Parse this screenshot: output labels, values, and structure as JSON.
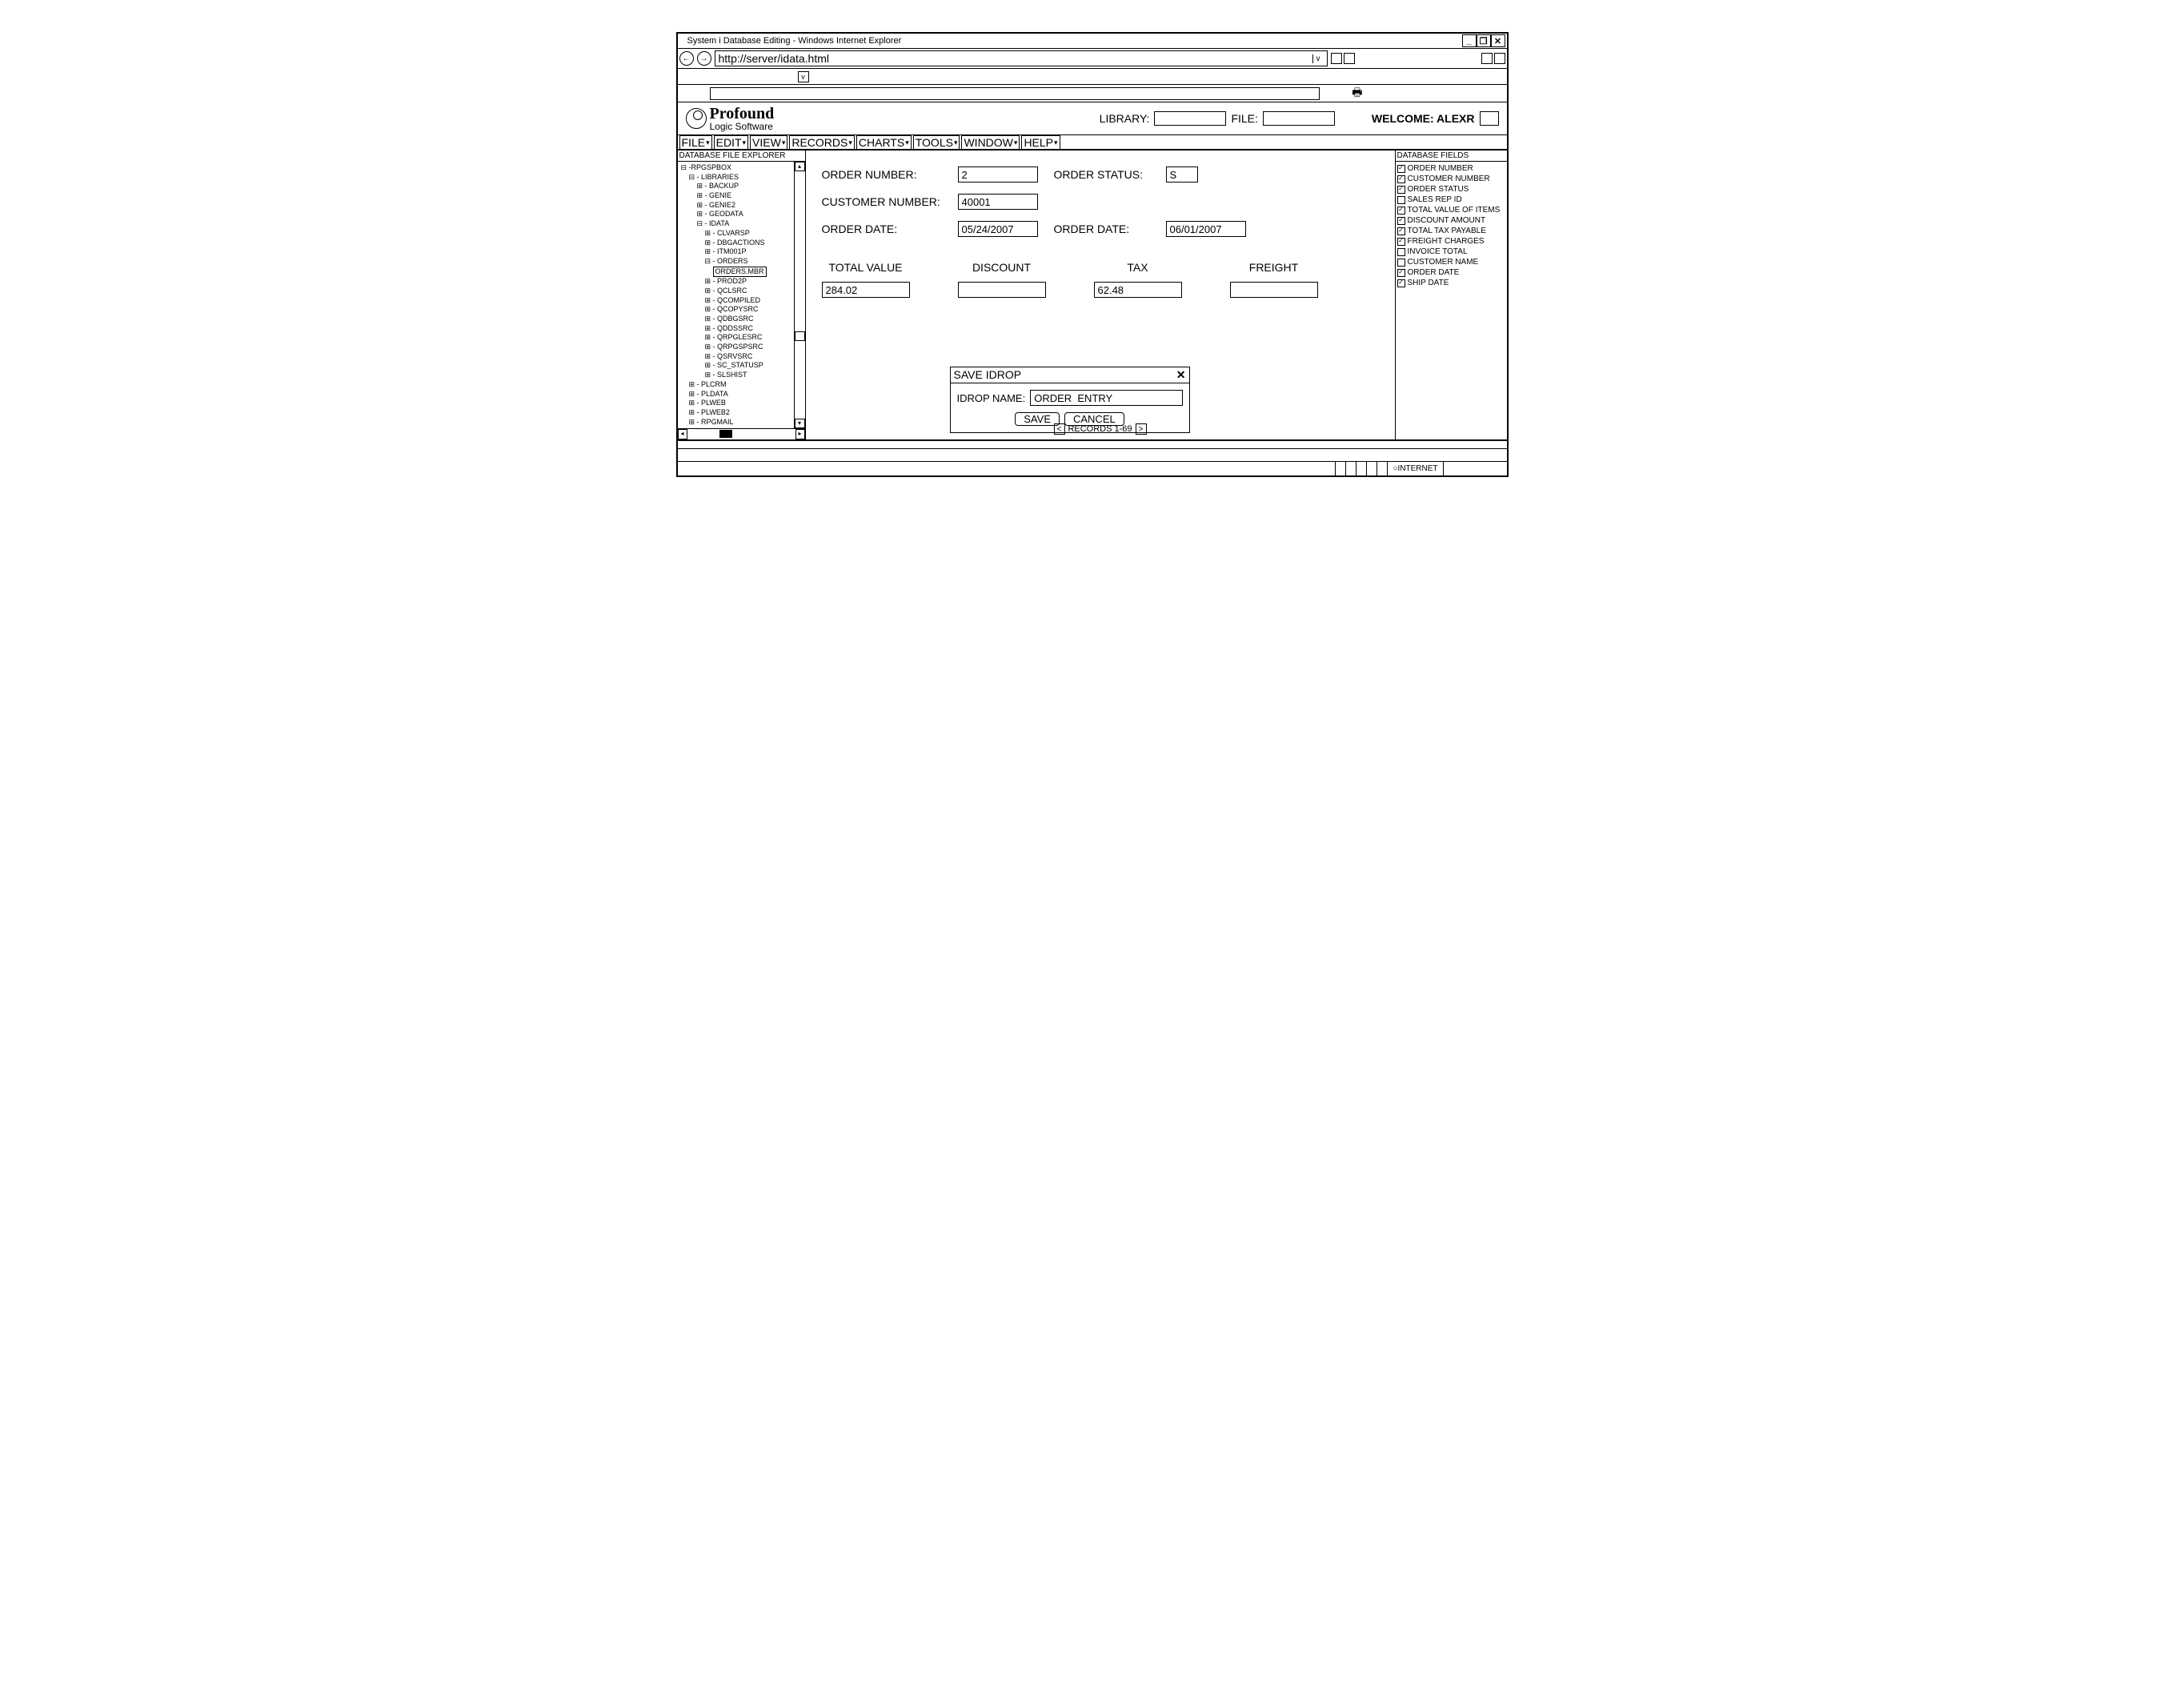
{
  "window_title": "System i Database Editing - Windows Internet Explorer",
  "url": "http://server/idata.html",
  "logo": {
    "line1": "Profound",
    "line2": "Logic Software"
  },
  "welcome": "WELCOME: ALEXR",
  "library_label": "LIBRARY:",
  "file_label": "FILE:",
  "menu": [
    "FILE",
    "EDIT",
    "VIEW",
    "RECORDS",
    "CHARTS",
    "TOOLS",
    "WINDOW",
    "HELP"
  ],
  "left_panel_title": "DATABASE FILE EXPLORER",
  "tree": [
    {
      "t": "⊟ -RPGSPBOX",
      "i": 0
    },
    {
      "t": "⊟ - LIBRARIES",
      "i": 1
    },
    {
      "t": "⊞ - BACKUP",
      "i": 2
    },
    {
      "t": "⊞ - GENIE",
      "i": 2
    },
    {
      "t": "⊞ - GENIE2",
      "i": 2
    },
    {
      "t": "⊞ - GEODATA",
      "i": 2
    },
    {
      "t": "⊟ - IDATA",
      "i": 2
    },
    {
      "t": "⊞ - CLVARSP",
      "i": 3
    },
    {
      "t": "⊞ - DBGACTIONS",
      "i": 3
    },
    {
      "t": "⊞ - ITM001P",
      "i": 3
    },
    {
      "t": "⊟ - ORDERS",
      "i": 3
    },
    {
      "t": "ORDERS.MBR",
      "i": 4,
      "sel": true
    },
    {
      "t": "⊞ - PROD2P",
      "i": 3
    },
    {
      "t": "⊞ - QCLSRC",
      "i": 3
    },
    {
      "t": "⊞ - QCOMPILED",
      "i": 3
    },
    {
      "t": "⊞ - QCOPYSRC",
      "i": 3
    },
    {
      "t": "⊞ - QDBGSRC",
      "i": 3
    },
    {
      "t": "⊞ - QDDSSRC",
      "i": 3
    },
    {
      "t": "⊞ - QRPGLESRC",
      "i": 3
    },
    {
      "t": "⊞ - QRPGSPSRC",
      "i": 3
    },
    {
      "t": "⊞ - QSRVSRC",
      "i": 3
    },
    {
      "t": "⊞ - SC_STATUSP",
      "i": 3
    },
    {
      "t": "⊞ - SLSHIST",
      "i": 3
    },
    {
      "t": "⊞ - PLCRM",
      "i": 1
    },
    {
      "t": "⊞ - PLDATA",
      "i": 1
    },
    {
      "t": "⊞ - PLWEB",
      "i": 1
    },
    {
      "t": "⊞ - PLWEB2",
      "i": 1
    },
    {
      "t": "⊞ - RPGMAIL",
      "i": 1
    }
  ],
  "form": {
    "order_number_label": "ORDER NUMBER:",
    "order_number": "2",
    "order_status_label": "ORDER STATUS:",
    "order_status": "S",
    "customer_number_label": "CUSTOMER NUMBER:",
    "customer_number": "40001",
    "order_date_label": "ORDER DATE:",
    "order_date1": "05/24/2007",
    "order_date_label2": "ORDER DATE:",
    "order_date2": "06/01/2007",
    "total_value_label": "TOTAL VALUE",
    "total_value": "284.02",
    "discount_label": "DISCOUNT",
    "discount": "",
    "tax_label": "TAX",
    "tax": "62.48",
    "freight_label": "FREIGHT",
    "freight": ""
  },
  "dialog": {
    "title": "SAVE IDROP",
    "name_label": "IDROP NAME:",
    "name_value": "ORDER  ENTRY",
    "save": "SAVE",
    "cancel": "CANCEL"
  },
  "records_label": "RECORDS 1-69",
  "right_panel_title": "DATABASE FIELDS",
  "fields": [
    {
      "label": "ORDER NUMBER",
      "checked": true
    },
    {
      "label": "CUSTOMER NUMBER",
      "checked": true
    },
    {
      "label": "ORDER STATUS",
      "checked": true
    },
    {
      "label": "SALES REP ID",
      "checked": false
    },
    {
      "label": "TOTAL VALUE OF ITEMS",
      "checked": true
    },
    {
      "label": "DISCOUNT AMOUNT",
      "checked": true
    },
    {
      "label": "TOTAL TAX PAYABLE",
      "checked": true
    },
    {
      "label": "FREIGHT CHARGES",
      "checked": true
    },
    {
      "label": "INVOICE TOTAL",
      "checked": false
    },
    {
      "label": "CUSTOMER NAME",
      "checked": false
    },
    {
      "label": "ORDER DATE",
      "checked": true
    },
    {
      "label": "SHIP DATE",
      "checked": true
    }
  ],
  "status_internet": "INTERNET"
}
